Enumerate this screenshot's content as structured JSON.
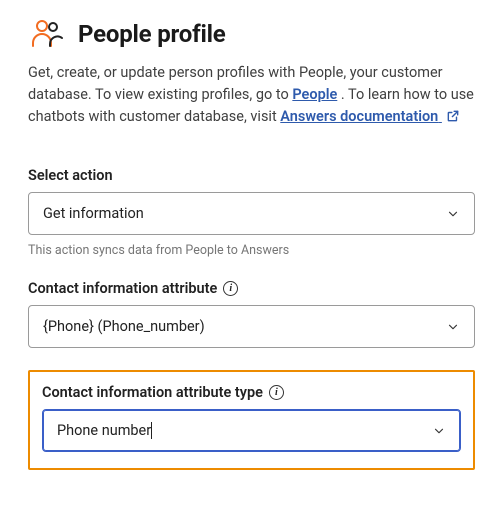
{
  "header": {
    "title": "People profile"
  },
  "description": {
    "part1": "Get, create, or update person profiles with People, your customer database. To view existing profiles, go to ",
    "link1": "People",
    "part2": ". To learn how to use chatbots with customer database, visit ",
    "link2": "Answers documentation"
  },
  "fields": {
    "action": {
      "label": "Select action",
      "value": "Get information",
      "helper": "This action syncs data from People to Answers"
    },
    "attribute": {
      "label": "Contact information attribute",
      "value": "{Phone} (Phone_number)"
    },
    "attribute_type": {
      "label": "Contact information attribute type",
      "value": "Phone number"
    }
  },
  "colors": {
    "accent_link": "#2e5aac",
    "highlight_border": "#ed8b00",
    "focus_border": "#3a5fc8",
    "icon_accent": "#f26c21"
  }
}
